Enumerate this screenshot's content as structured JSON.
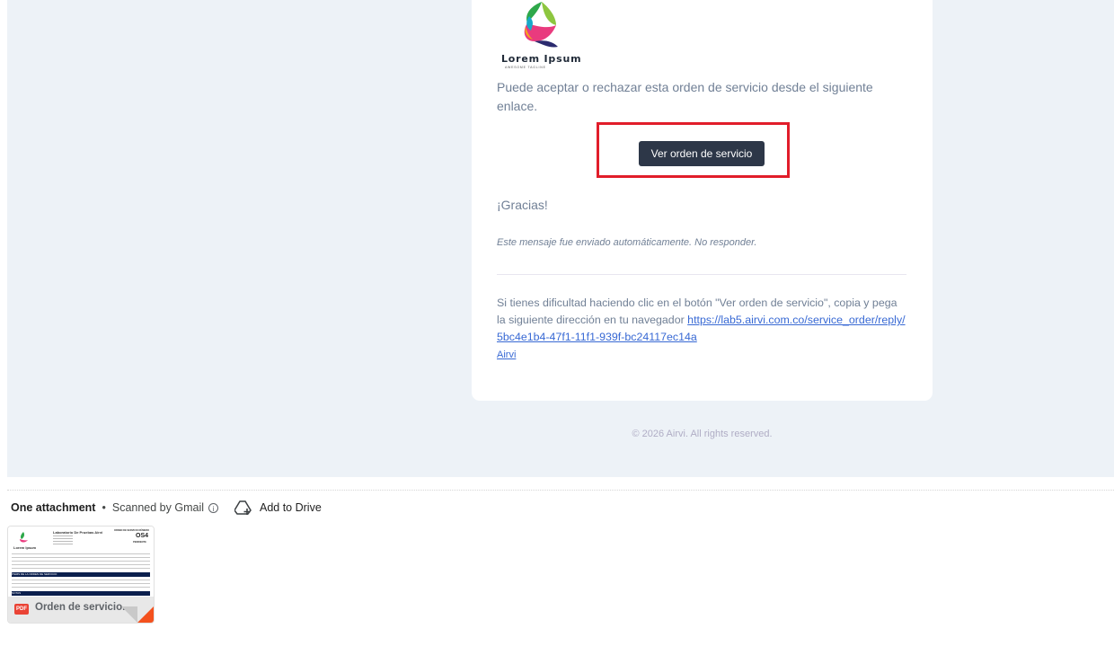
{
  "email": {
    "logo": {
      "name": "Lorem Ipsum",
      "tagline": "AWESOME TAGLINE"
    },
    "intro_text": "Puede aceptar o rechazar esta orden de servicio desde el siguiente enlace.",
    "button_label": "Ver orden de servicio",
    "thanks": "¡Gracias!",
    "auto_message": "Este mensaje fue enviado automáticamente. No responder.",
    "help_text": "Si tienes dificultad haciendo clic en el botón \"Ver orden de servicio\", copia y pega la siguiente dirección en tu navegador ",
    "help_link": "https://lab5.airvi.com.co/service_order/reply/5bc4e1b4-47f1-11f1-939f-bc24117ec14a",
    "airvi_link": "Airvi",
    "footer": "© 2026 Airvi. All rights reserved."
  },
  "attachments": {
    "count_label": "One attachment",
    "scan_label": "Scanned by Gmail",
    "add_to_drive": "Add to Drive",
    "file": {
      "name": "Orden de servicio...",
      "type": "PDF",
      "preview": {
        "lab_title": "Laboratorio De Pruebas Airvi",
        "doc_title": "ORDEN DE SERVICIO NÚMERO",
        "doc_number": "OS4",
        "status": "PENDIENTE",
        "section_items": "ÍTEMS DE LA ORDEN DE SERVICIO",
        "section_notes": "NOTAS",
        "logo_text": "Lorem Ipsum"
      }
    }
  },
  "colors": {
    "button": "#2d3748",
    "highlight": "#e11d2a",
    "link": "#3869d4",
    "background": "#edf2f7"
  }
}
